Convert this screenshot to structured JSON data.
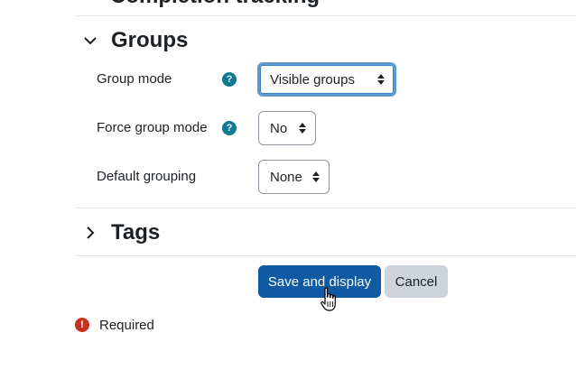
{
  "previous_section": {
    "title": "Completion tracking"
  },
  "groups_section": {
    "title": "Groups",
    "expanded": true,
    "icon": "chevron-down-icon",
    "fields": {
      "group_mode": {
        "label": "Group mode",
        "value": "Visible groups",
        "help_icon": "?"
      },
      "force_group_mode": {
        "label": "Force group mode",
        "value": "No",
        "help_icon": "?"
      },
      "default_grouping": {
        "label": "Default grouping",
        "value": "None"
      }
    }
  },
  "tags_section": {
    "title": "Tags",
    "expanded": false,
    "icon": "chevron-right-icon"
  },
  "actions": {
    "save_label": "Save and display",
    "cancel_label": "Cancel"
  },
  "required_note": {
    "icon": "!",
    "text": "Required"
  },
  "colors": {
    "primary": "#0f5aa3",
    "secondary": "#ced4da",
    "help": "#0e7a92",
    "required": "#ca3120",
    "focus": "#5b9bd5"
  }
}
